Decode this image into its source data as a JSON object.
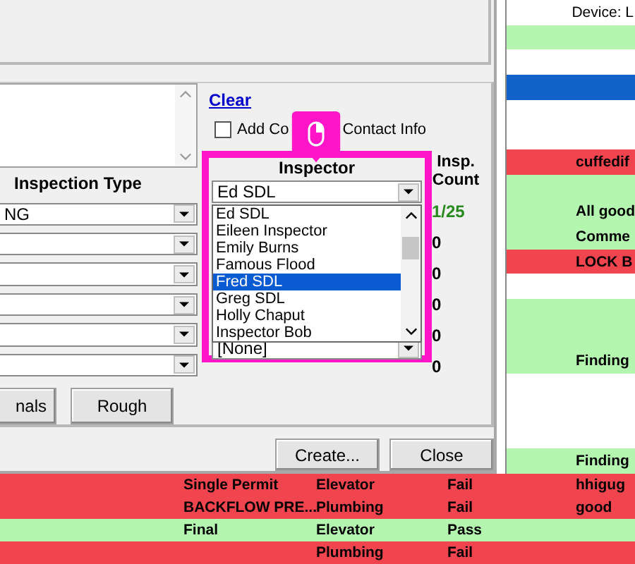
{
  "side_rows": [
    {
      "text": "Device: L"
    },
    {
      "color": "#b4f5b0",
      "text": ""
    },
    {
      "text": ""
    },
    {
      "color": "#1062c8",
      "text": ""
    },
    {
      "text": ""
    },
    {
      "text": ""
    },
    {
      "color": "#f0444e",
      "text": "cuffedif"
    },
    {
      "color": "#b4f5b0",
      "text": ""
    },
    {
      "color": "#b4f5b0",
      "text": "All good"
    },
    {
      "color": "#b4f5b0",
      "text": "Comme"
    },
    {
      "color": "#f0444e",
      "text": "LOCK B"
    },
    {
      "text": ""
    },
    {
      "color": "#b4f5b0",
      "text": ""
    },
    {
      "color": "#b4f5b0",
      "text": ""
    },
    {
      "color": "#b4f5b0",
      "text": "Finding"
    },
    {
      "text": ""
    },
    {
      "text": ""
    },
    {
      "text": ""
    },
    {
      "color": "#b4f5b0",
      "text": "Finding"
    }
  ],
  "dialog": {
    "clear_link": "Clear",
    "checkbox": {
      "label_parts": [
        "Add Co",
        "Contact Info"
      ],
      "checked": false
    },
    "columns": {
      "type": "Inspection Type",
      "inspector": "Inspector",
      "count": [
        "Insp.",
        "Count"
      ]
    },
    "rows": [
      {
        "type": "NG",
        "inspector": "Ed SDL",
        "count": "1/25",
        "count_highlight": true
      },
      {
        "type": "",
        "count": "0",
        "count_highlight": false
      },
      {
        "type": "",
        "count": "0",
        "count_highlight": false
      },
      {
        "type": "",
        "count": "0",
        "count_highlight": false
      },
      {
        "type": "",
        "count": "0",
        "count_highlight": false
      },
      {
        "type": "",
        "inspector": "[None]",
        "count": "0",
        "count_highlight": false
      }
    ],
    "inspector_list": [
      {
        "label": "Ed SDL",
        "selected": false
      },
      {
        "label": "Eileen Inspector",
        "selected": false
      },
      {
        "label": "Emily Burns",
        "selected": false
      },
      {
        "label": "Famous Flood",
        "selected": false
      },
      {
        "label": "Fred SDL",
        "selected": true
      },
      {
        "label": "Greg SDL",
        "selected": false
      },
      {
        "label": "Holly Chaput",
        "selected": false
      },
      {
        "label": "Inspector Bob",
        "selected": false
      }
    ],
    "preset_buttons": [
      "nals",
      "Rough"
    ],
    "buttons": [
      "Create...",
      "Close"
    ]
  },
  "table_rows": [
    {
      "color": "#f0444e",
      "cells": [
        "Single Permit",
        "Elevator",
        "Fail",
        "hhigug"
      ]
    },
    {
      "color": "#f0444e",
      "cells": [
        "BACKFLOW PRE...",
        "Plumbing",
        "Fail",
        "good"
      ]
    },
    {
      "color": "#b4f5b0",
      "cells": [
        "Final",
        "Elevator",
        "Pass",
        ""
      ]
    },
    {
      "color": "#f0444e",
      "cells": [
        "",
        "Plumbing",
        "Fail",
        ""
      ]
    }
  ]
}
